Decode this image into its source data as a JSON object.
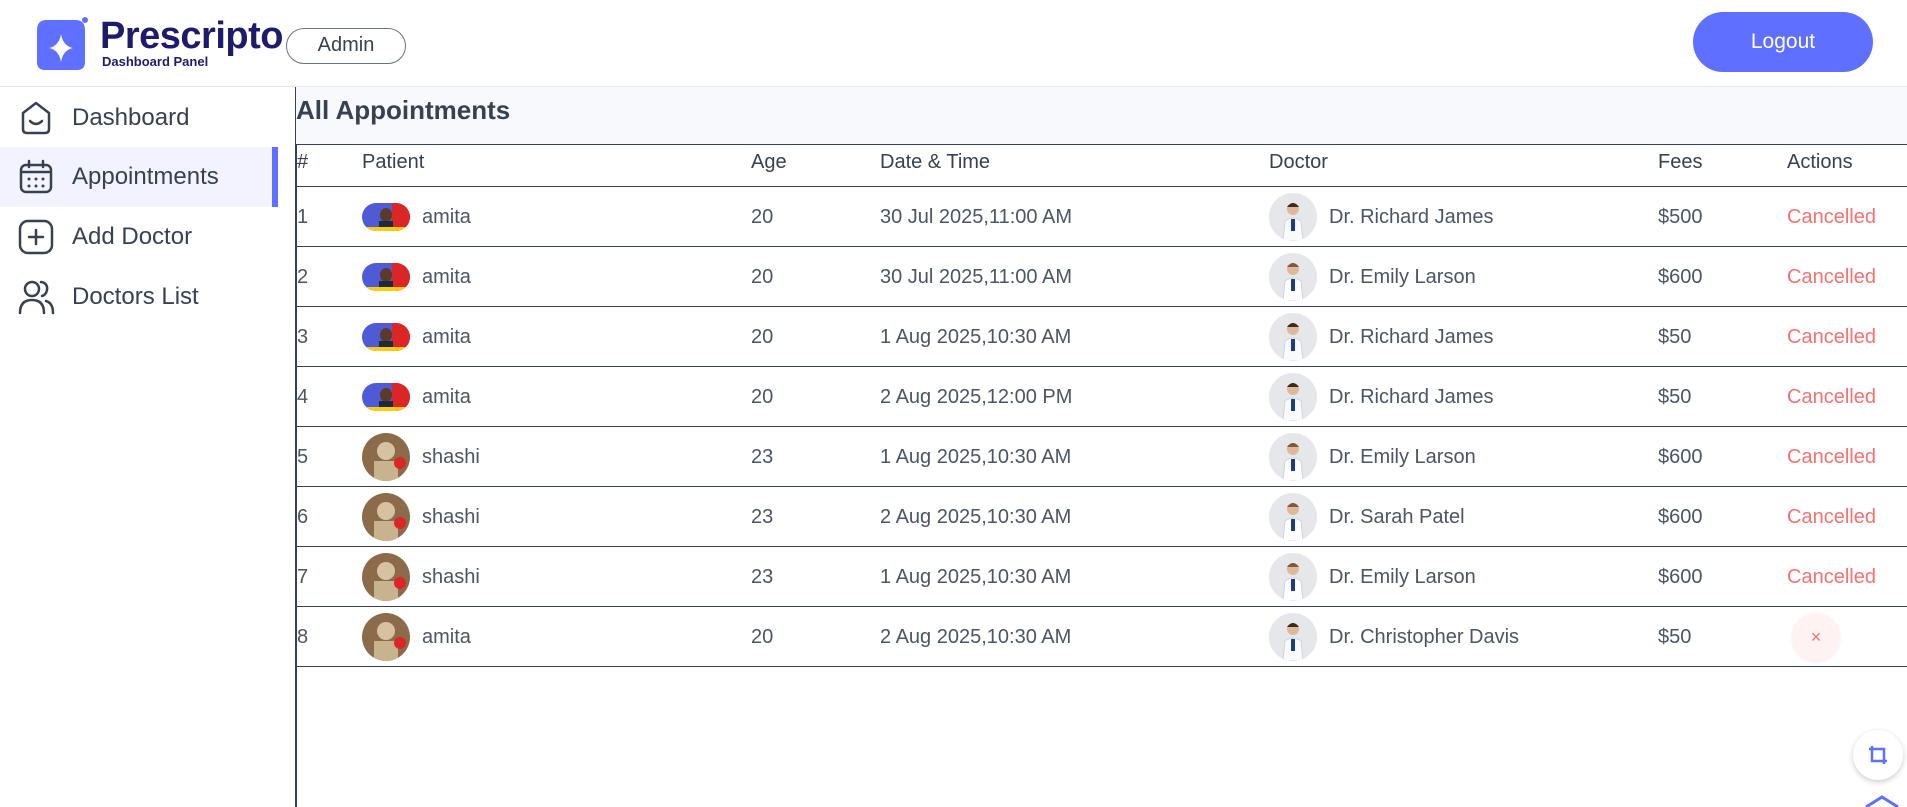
{
  "header": {
    "brand": "Prescripto",
    "brand_sub": "Dashboard Panel",
    "role_badge": "Admin",
    "logout_label": "Logout"
  },
  "sidebar": {
    "items": [
      {
        "label": "Dashboard",
        "icon": "home-icon",
        "active": false
      },
      {
        "label": "Appointments",
        "icon": "calendar-icon",
        "active": true
      },
      {
        "label": "Add Doctor",
        "icon": "add-icon",
        "active": false
      },
      {
        "label": "Doctors List",
        "icon": "people-icon",
        "active": false
      }
    ]
  },
  "main": {
    "title": "All Appointments",
    "columns": [
      "#",
      "Patient",
      "Age",
      "Date & Time",
      "Doctor",
      "Fees",
      "Actions"
    ],
    "rows": [
      {
        "num": "1",
        "patient": "amita",
        "age": "20",
        "datetime": "30 Jul 2025,11:00 AM",
        "doctor": "Dr. Richard James",
        "fees": "$500",
        "action": "Cancelled"
      },
      {
        "num": "2",
        "patient": "amita",
        "age": "20",
        "datetime": "30 Jul 2025,11:00 AM",
        "doctor": "Dr. Emily Larson",
        "fees": "$600",
        "action": "Cancelled"
      },
      {
        "num": "3",
        "patient": "amita",
        "age": "20",
        "datetime": "1 Aug 2025,10:30 AM",
        "doctor": "Dr. Richard James",
        "fees": "$50",
        "action": "Cancelled"
      },
      {
        "num": "4",
        "patient": "amita",
        "age": "20",
        "datetime": "2 Aug 2025,12:00 PM",
        "doctor": "Dr. Richard James",
        "fees": "$50",
        "action": "Cancelled"
      },
      {
        "num": "5",
        "patient": "shashi",
        "age": "23",
        "datetime": "1 Aug 2025,10:30 AM",
        "doctor": "Dr. Emily Larson",
        "fees": "$600",
        "action": "Cancelled"
      },
      {
        "num": "6",
        "patient": "shashi",
        "age": "23",
        "datetime": "2 Aug 2025,10:30 AM",
        "doctor": "Dr. Sarah Patel",
        "fees": "$600",
        "action": "Cancelled"
      },
      {
        "num": "7",
        "patient": "shashi",
        "age": "23",
        "datetime": "1 Aug 2025,10:30 AM",
        "doctor": "Dr. Emily Larson",
        "fees": "$600",
        "action": "Cancelled"
      },
      {
        "num": "8",
        "patient": "amita",
        "age": "20",
        "datetime": "2 Aug 2025,10:30 AM",
        "doctor": "Dr. Christopher Davis",
        "fees": "$50",
        "action": "×"
      }
    ]
  },
  "colors": {
    "accent": "#5f6fff",
    "cancelled": "#f87171",
    "brand_text": "#1e1b6b"
  }
}
